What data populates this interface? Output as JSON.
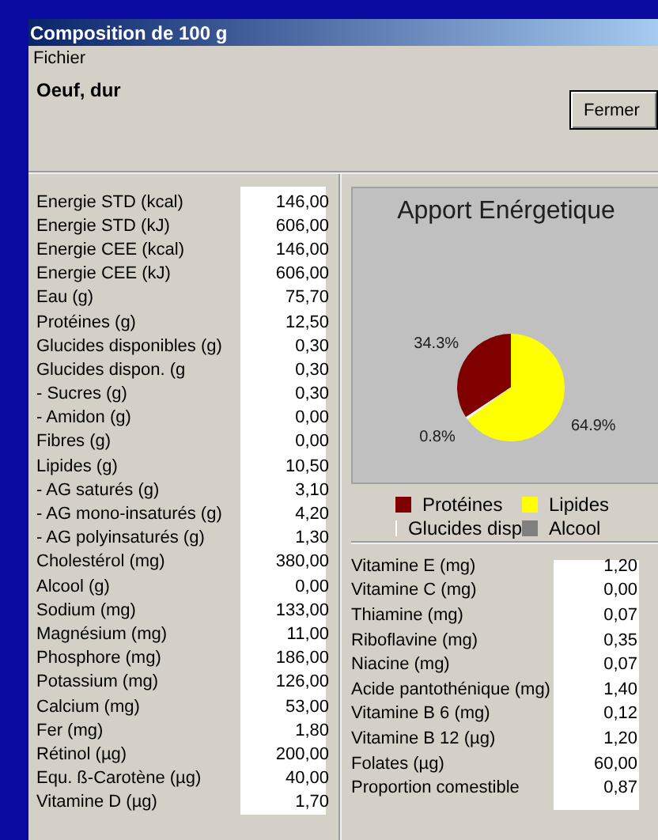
{
  "window": {
    "title": "Composition de 100 g"
  },
  "menu": [
    "Fichier"
  ],
  "food_name": "Oeuf, dur",
  "close_button": "Fermer",
  "nutrients": [
    {
      "label": "Energie STD (kcal)",
      "value": "146,00"
    },
    {
      "label": "Energie STD (kJ)",
      "value": "606,00"
    },
    {
      "label": "Energie CEE (kcal)",
      "value": "146,00"
    },
    {
      "label": "Energie CEE (kJ)",
      "value": "606,00"
    },
    {
      "label": "Eau (g)",
      "value": "75,70"
    },
    {
      "label": "Protéines (g)",
      "value": "12,50"
    },
    {
      "label": "Glucides disponibles (g)",
      "value": "0,30"
    },
    {
      "label": "Glucides dispon. (g",
      "value": "0,30"
    },
    {
      "label": "- Sucres (g)",
      "value": "0,30"
    },
    {
      "label": "- Amidon (g)",
      "value": "0,00"
    },
    {
      "label": "Fibres (g)",
      "value": "0,00"
    },
    {
      "label": "Lipides (g)",
      "value": "10,50"
    },
    {
      "label": "- AG saturés (g)",
      "value": "3,10"
    },
    {
      "label": "- AG mono-insaturés (g)",
      "value": "4,20"
    },
    {
      "label": "- AG polyinsaturés (g)",
      "value": "1,30"
    },
    {
      "label": "Cholestérol (mg)",
      "value": "380,00"
    },
    {
      "label": "Alcool (g)",
      "value": "0,00"
    },
    {
      "label": "Sodium (mg)",
      "value": "133,00"
    },
    {
      "label": "Magnésium (mg)",
      "value": "11,00"
    },
    {
      "label": "Phosphore (mg)",
      "value": "186,00"
    },
    {
      "label": "Potassium (mg)",
      "value": "126,00"
    },
    {
      "label": "Calcium (mg)",
      "value": "53,00"
    },
    {
      "label": "Fer (mg)",
      "value": "1,80"
    },
    {
      "label": "Rétinol (µg)",
      "value": "200,00"
    },
    {
      "label": "Equ. ß-Carotène (µg)",
      "value": "40,00"
    },
    {
      "label": "Vitamine D (µg)",
      "value": "1,70"
    }
  ],
  "chart": {
    "chart_data": {
      "type": "pie",
      "title": "Apport Enérgetique",
      "categories": [
        "Protéines",
        "Glucides disp",
        "Lipides",
        "Alcool"
      ],
      "series": [
        {
          "colors": [
            "#800000",
            "#ffffff",
            "#ffff00",
            "#808080"
          ],
          "values": [
            34.3,
            0.8,
            64.9,
            0.0
          ]
        }
      ],
      "value_labels": [
        "34.3%",
        "0.8%",
        "64.9%",
        null
      ]
    }
  },
  "vitamins": [
    {
      "label": "Vitamine E (mg)",
      "value": "1,20"
    },
    {
      "label": "Vitamine C (mg)",
      "value": "0,00"
    },
    {
      "label": "Thiamine (mg)",
      "value": "0,07"
    },
    {
      "label": "Riboflavine (mg)",
      "value": "0,35"
    },
    {
      "label": "Niacine (mg)",
      "value": "0,07"
    },
    {
      "label": "Acide pantothénique (mg)",
      "value": "1,40"
    },
    {
      "label": "Vitamine B 6 (mg)",
      "value": "0,12"
    },
    {
      "label": "Vitamine B 12 (µg)",
      "value": "1,20"
    },
    {
      "label": "Folates (µg)",
      "value": "60,00"
    },
    {
      "label": "Proportion comestible",
      "value": "0,87"
    }
  ]
}
